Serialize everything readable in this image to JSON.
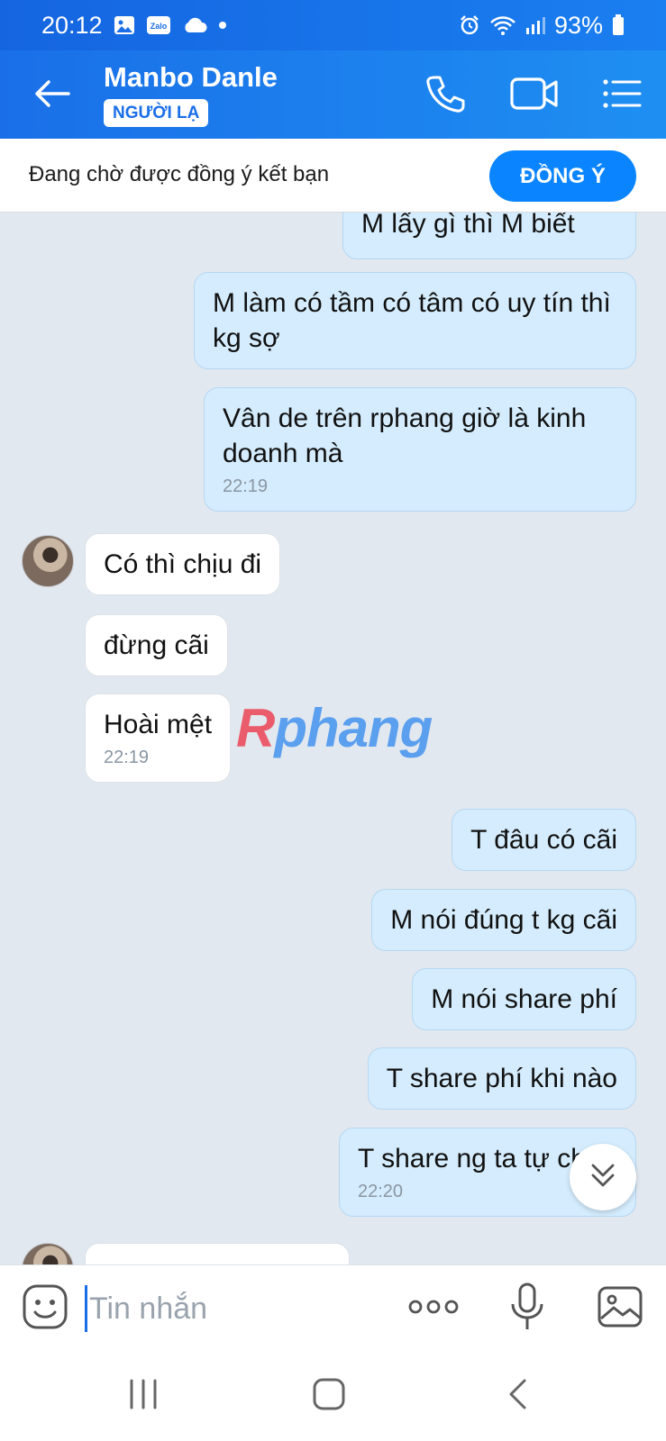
{
  "status_bar": {
    "time": "20:12",
    "battery": "93%",
    "icons": [
      "gallery-icon",
      "zalo-icon",
      "cloud-icon",
      "dot-icon",
      "alarm-icon",
      "wifi-icon",
      "signal-icon",
      "battery-icon"
    ],
    "zalo_label": "Zalo"
  },
  "header": {
    "contact_name": "Manbo Danle",
    "badge": "NGƯỜI LẠ",
    "background_color": "#1a6fe8",
    "icons": [
      "back-arrow-icon",
      "phone-icon",
      "video-camera-icon",
      "menu-list-icon"
    ]
  },
  "friend_request": {
    "text": "Đang chờ được đồng ý kết bạn",
    "accept_label": "ĐỒNG Ý",
    "accept_color": "#0a84ff"
  },
  "messages": [
    {
      "direction": "out",
      "text": "M lấy gì thì M biết"
    },
    {
      "direction": "out",
      "text": "M làm có tầm có tâm có uy tín thì kg sợ"
    },
    {
      "direction": "out",
      "text": "Vân de trên rphang giờ là kinh doanh mà",
      "time": "22:19"
    },
    {
      "direction": "in",
      "text": "Có thì chịu đi"
    },
    {
      "direction": "in",
      "text": "đừng cãi"
    },
    {
      "direction": "in",
      "text": "Hoài mệt",
      "time": "22:19"
    },
    {
      "direction": "out",
      "text": "T đâu có cãi"
    },
    {
      "direction": "out",
      "text": "M nói đúng t kg cãi"
    },
    {
      "direction": "out",
      "text": "M nói share phí"
    },
    {
      "direction": "out",
      "text": "T share phí khi nào"
    },
    {
      "direction": "out",
      "text": "T share ng ta tự cho",
      "time": "22:20"
    }
  ],
  "watermark": {
    "r": "R",
    "rest": "phang"
  },
  "input_bar": {
    "placeholder": "Tin nhắn",
    "icons": [
      "sticker-icon",
      "more-options-icon",
      "microphone-icon",
      "image-icon"
    ]
  },
  "nav_bar": {
    "icons": [
      "recent-apps-icon",
      "home-icon",
      "back-icon"
    ]
  }
}
